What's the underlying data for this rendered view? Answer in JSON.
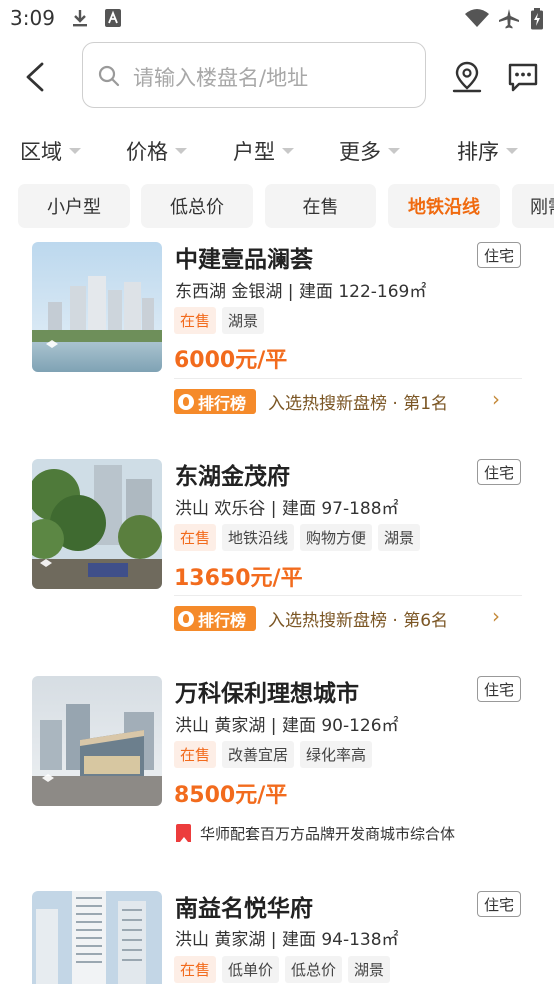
{
  "status_bar": {
    "time": "3:09",
    "icons": [
      "download-icon",
      "text-a-icon",
      "wifi-icon",
      "airplane-mode-icon",
      "battery-charging-icon"
    ]
  },
  "header": {
    "search_placeholder": "请输入楼盘名/地址",
    "icons": [
      "back-arrow-icon",
      "search-icon",
      "location-pin-icon",
      "message-icon"
    ]
  },
  "filters": [
    {
      "label": "区域"
    },
    {
      "label": "价格"
    },
    {
      "label": "户型"
    },
    {
      "label": "更多"
    },
    {
      "label": "排序"
    }
  ],
  "chips": [
    {
      "label": "小户型",
      "active": false
    },
    {
      "label": "低总价",
      "active": false
    },
    {
      "label": "在售",
      "active": false
    },
    {
      "label": "地铁沿线",
      "active": true
    },
    {
      "label": "刚需",
      "active": false
    }
  ],
  "listings": [
    {
      "title": "中建壹品澜荟",
      "type": "住宅",
      "location": "东西湖 金银湖 | 建面 122-169㎡",
      "tags": [
        "在售",
        "湖景"
      ],
      "price": "6000元/平",
      "rank_badge": "排行榜",
      "rank_text": "入选热搜新盘榜 · 第1名"
    },
    {
      "title": "东湖金茂府",
      "type": "住宅",
      "location": "洪山 欢乐谷 | 建面 97-188㎡",
      "tags": [
        "在售",
        "地铁沿线",
        "购物方便",
        "湖景"
      ],
      "price": "13650元/平",
      "rank_badge": "排行榜",
      "rank_text": "入选热搜新盘榜 · 第6名"
    },
    {
      "title": "万科保利理想城市",
      "type": "住宅",
      "location": "洪山 黄家湖 | 建面 90-126㎡",
      "tags": [
        "在售",
        "改善宜居",
        "绿化率高"
      ],
      "price": "8500元/平",
      "promo_text": "华师配套百万方品牌开发商城市综合体"
    },
    {
      "title": "南益名悦华府",
      "type": "住宅",
      "location": "洪山 黄家湖 | 建面 94-138㎡",
      "tags": [
        "在售",
        "低单价",
        "低总价",
        "湖景"
      ]
    }
  ],
  "colors": {
    "accent": "#f26b1d",
    "rank_badge": "#f58a2a",
    "promo_icon": "#ec3c3c"
  }
}
